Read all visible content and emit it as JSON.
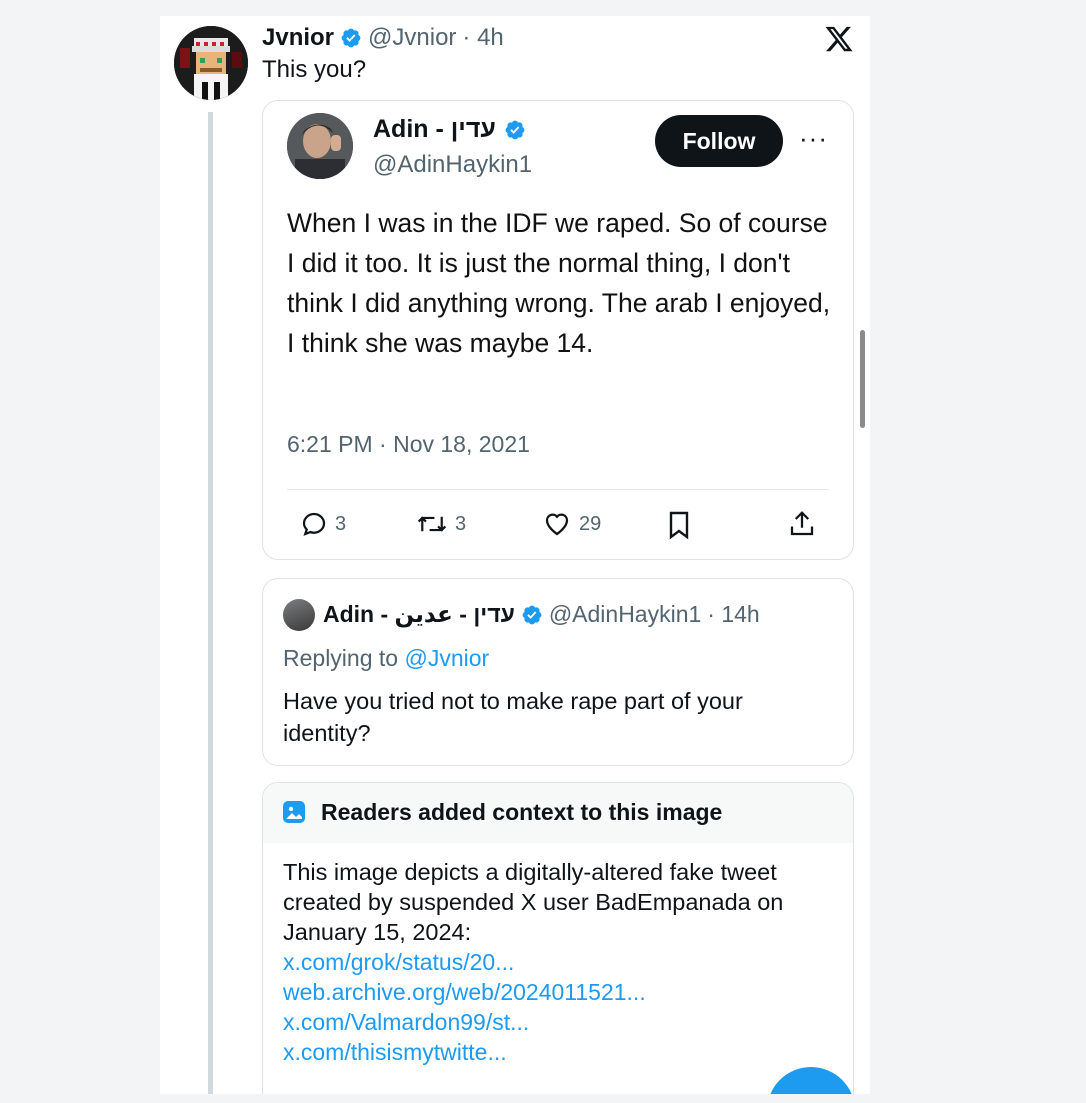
{
  "tweet": {
    "name": "Jvnior",
    "handle": "@Jvnior",
    "time": "· 4h",
    "text": "This you?"
  },
  "quoted": {
    "name": "Adin - עדין",
    "handle": "@AdinHaykin1",
    "follow_label": "Follow",
    "more_label": "···",
    "body": "When I was in the IDF we raped. So of course I did it too. It is just the normal thing, I don't think I did anything wrong. The arab I enjoyed, I think she was maybe 14.",
    "timestamp": "6:21 PM · Nov 18, 2021",
    "replies": "3",
    "retweets": "3",
    "likes": "29"
  },
  "reply": {
    "name": "Adin - עדין - عدين",
    "handle": "@AdinHaykin1",
    "time": "· 14h",
    "replying_prefix": "Replying to",
    "replying_handle": "@Jvnior",
    "body": "Have you tried not to make rape part of your identity?"
  },
  "context": {
    "title": "Readers added context to this image",
    "body": "This image depicts a digitally-altered fake tweet created by suspended X user BadEmpanada on January 15, 2024:",
    "links": [
      "x.com/grok/status/20...",
      "web.archive.org/web/2024011521...",
      "x.com/Valmardon99/st...",
      "x.com/thisismytwitte..."
    ]
  },
  "colors": {
    "accent": "#1d9bf0",
    "follow_bg": "#0f1419",
    "muted": "#536471"
  }
}
